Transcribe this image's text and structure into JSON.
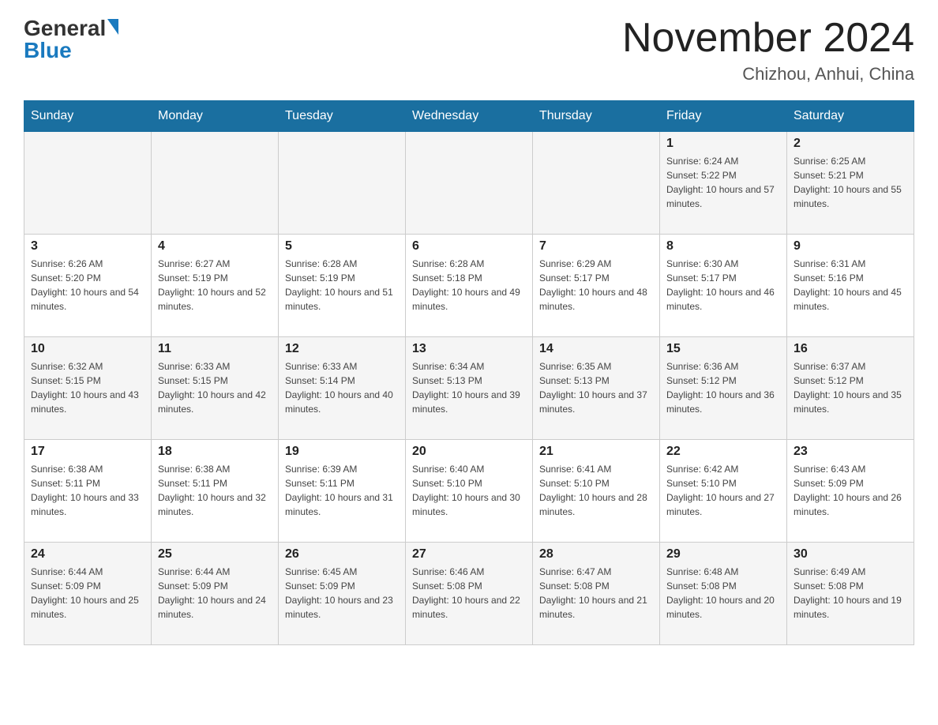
{
  "header": {
    "logo_general": "General",
    "logo_blue": "Blue",
    "month_year": "November 2024",
    "location": "Chizhou, Anhui, China"
  },
  "days_of_week": [
    "Sunday",
    "Monday",
    "Tuesday",
    "Wednesday",
    "Thursday",
    "Friday",
    "Saturday"
  ],
  "weeks": [
    [
      {
        "day": "",
        "sunrise": "",
        "sunset": "",
        "daylight": ""
      },
      {
        "day": "",
        "sunrise": "",
        "sunset": "",
        "daylight": ""
      },
      {
        "day": "",
        "sunrise": "",
        "sunset": "",
        "daylight": ""
      },
      {
        "day": "",
        "sunrise": "",
        "sunset": "",
        "daylight": ""
      },
      {
        "day": "",
        "sunrise": "",
        "sunset": "",
        "daylight": ""
      },
      {
        "day": "1",
        "sunrise": "Sunrise: 6:24 AM",
        "sunset": "Sunset: 5:22 PM",
        "daylight": "Daylight: 10 hours and 57 minutes."
      },
      {
        "day": "2",
        "sunrise": "Sunrise: 6:25 AM",
        "sunset": "Sunset: 5:21 PM",
        "daylight": "Daylight: 10 hours and 55 minutes."
      }
    ],
    [
      {
        "day": "3",
        "sunrise": "Sunrise: 6:26 AM",
        "sunset": "Sunset: 5:20 PM",
        "daylight": "Daylight: 10 hours and 54 minutes."
      },
      {
        "day": "4",
        "sunrise": "Sunrise: 6:27 AM",
        "sunset": "Sunset: 5:19 PM",
        "daylight": "Daylight: 10 hours and 52 minutes."
      },
      {
        "day": "5",
        "sunrise": "Sunrise: 6:28 AM",
        "sunset": "Sunset: 5:19 PM",
        "daylight": "Daylight: 10 hours and 51 minutes."
      },
      {
        "day": "6",
        "sunrise": "Sunrise: 6:28 AM",
        "sunset": "Sunset: 5:18 PM",
        "daylight": "Daylight: 10 hours and 49 minutes."
      },
      {
        "day": "7",
        "sunrise": "Sunrise: 6:29 AM",
        "sunset": "Sunset: 5:17 PM",
        "daylight": "Daylight: 10 hours and 48 minutes."
      },
      {
        "day": "8",
        "sunrise": "Sunrise: 6:30 AM",
        "sunset": "Sunset: 5:17 PM",
        "daylight": "Daylight: 10 hours and 46 minutes."
      },
      {
        "day": "9",
        "sunrise": "Sunrise: 6:31 AM",
        "sunset": "Sunset: 5:16 PM",
        "daylight": "Daylight: 10 hours and 45 minutes."
      }
    ],
    [
      {
        "day": "10",
        "sunrise": "Sunrise: 6:32 AM",
        "sunset": "Sunset: 5:15 PM",
        "daylight": "Daylight: 10 hours and 43 minutes."
      },
      {
        "day": "11",
        "sunrise": "Sunrise: 6:33 AM",
        "sunset": "Sunset: 5:15 PM",
        "daylight": "Daylight: 10 hours and 42 minutes."
      },
      {
        "day": "12",
        "sunrise": "Sunrise: 6:33 AM",
        "sunset": "Sunset: 5:14 PM",
        "daylight": "Daylight: 10 hours and 40 minutes."
      },
      {
        "day": "13",
        "sunrise": "Sunrise: 6:34 AM",
        "sunset": "Sunset: 5:13 PM",
        "daylight": "Daylight: 10 hours and 39 minutes."
      },
      {
        "day": "14",
        "sunrise": "Sunrise: 6:35 AM",
        "sunset": "Sunset: 5:13 PM",
        "daylight": "Daylight: 10 hours and 37 minutes."
      },
      {
        "day": "15",
        "sunrise": "Sunrise: 6:36 AM",
        "sunset": "Sunset: 5:12 PM",
        "daylight": "Daylight: 10 hours and 36 minutes."
      },
      {
        "day": "16",
        "sunrise": "Sunrise: 6:37 AM",
        "sunset": "Sunset: 5:12 PM",
        "daylight": "Daylight: 10 hours and 35 minutes."
      }
    ],
    [
      {
        "day": "17",
        "sunrise": "Sunrise: 6:38 AM",
        "sunset": "Sunset: 5:11 PM",
        "daylight": "Daylight: 10 hours and 33 minutes."
      },
      {
        "day": "18",
        "sunrise": "Sunrise: 6:38 AM",
        "sunset": "Sunset: 5:11 PM",
        "daylight": "Daylight: 10 hours and 32 minutes."
      },
      {
        "day": "19",
        "sunrise": "Sunrise: 6:39 AM",
        "sunset": "Sunset: 5:11 PM",
        "daylight": "Daylight: 10 hours and 31 minutes."
      },
      {
        "day": "20",
        "sunrise": "Sunrise: 6:40 AM",
        "sunset": "Sunset: 5:10 PM",
        "daylight": "Daylight: 10 hours and 30 minutes."
      },
      {
        "day": "21",
        "sunrise": "Sunrise: 6:41 AM",
        "sunset": "Sunset: 5:10 PM",
        "daylight": "Daylight: 10 hours and 28 minutes."
      },
      {
        "day": "22",
        "sunrise": "Sunrise: 6:42 AM",
        "sunset": "Sunset: 5:10 PM",
        "daylight": "Daylight: 10 hours and 27 minutes."
      },
      {
        "day": "23",
        "sunrise": "Sunrise: 6:43 AM",
        "sunset": "Sunset: 5:09 PM",
        "daylight": "Daylight: 10 hours and 26 minutes."
      }
    ],
    [
      {
        "day": "24",
        "sunrise": "Sunrise: 6:44 AM",
        "sunset": "Sunset: 5:09 PM",
        "daylight": "Daylight: 10 hours and 25 minutes."
      },
      {
        "day": "25",
        "sunrise": "Sunrise: 6:44 AM",
        "sunset": "Sunset: 5:09 PM",
        "daylight": "Daylight: 10 hours and 24 minutes."
      },
      {
        "day": "26",
        "sunrise": "Sunrise: 6:45 AM",
        "sunset": "Sunset: 5:09 PM",
        "daylight": "Daylight: 10 hours and 23 minutes."
      },
      {
        "day": "27",
        "sunrise": "Sunrise: 6:46 AM",
        "sunset": "Sunset: 5:08 PM",
        "daylight": "Daylight: 10 hours and 22 minutes."
      },
      {
        "day": "28",
        "sunrise": "Sunrise: 6:47 AM",
        "sunset": "Sunset: 5:08 PM",
        "daylight": "Daylight: 10 hours and 21 minutes."
      },
      {
        "day": "29",
        "sunrise": "Sunrise: 6:48 AM",
        "sunset": "Sunset: 5:08 PM",
        "daylight": "Daylight: 10 hours and 20 minutes."
      },
      {
        "day": "30",
        "sunrise": "Sunrise: 6:49 AM",
        "sunset": "Sunset: 5:08 PM",
        "daylight": "Daylight: 10 hours and 19 minutes."
      }
    ]
  ]
}
